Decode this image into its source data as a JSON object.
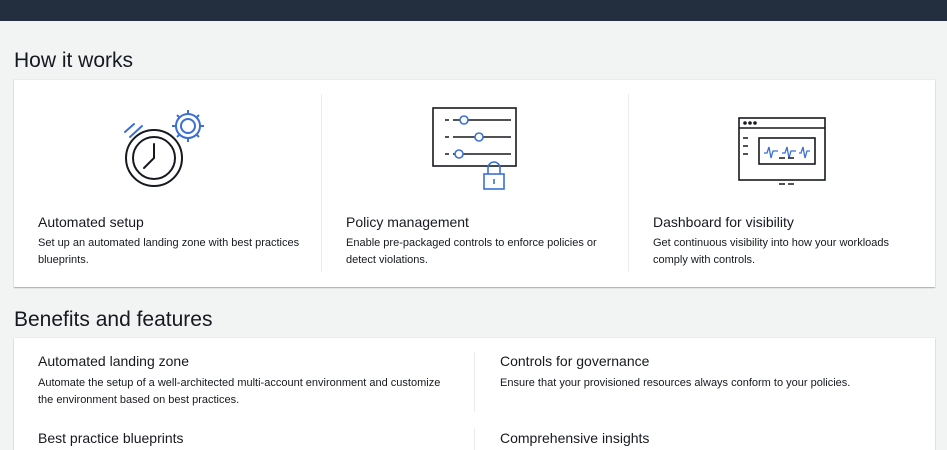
{
  "how_it_works": {
    "title": "How it works",
    "items": [
      {
        "icon": "automated-setup-icon",
        "title": "Automated setup",
        "description": "Set up an automated landing zone with best practices blueprints."
      },
      {
        "icon": "policy-management-icon",
        "title": "Policy management",
        "description": "Enable pre-packaged controls to enforce policies or detect violations."
      },
      {
        "icon": "dashboard-icon",
        "title": "Dashboard for visibility",
        "description": "Get continuous visibility into how your workloads comply with controls."
      }
    ]
  },
  "benefits": {
    "title": "Benefits and features",
    "items": [
      {
        "title": "Automated landing zone",
        "description": "Automate the setup of a well-architected multi-account environment and customize the environment based on best practices."
      },
      {
        "title": "Controls for governance",
        "description": "Ensure that your provisioned resources always conform to your policies."
      },
      {
        "title": "Best practice blueprints",
        "description": ""
      },
      {
        "title": "Comprehensive insights",
        "description": ""
      }
    ]
  },
  "colors": {
    "topbar": "#232f3e",
    "background": "#f2f3f3",
    "accent_blue": "#3b6fd6"
  }
}
